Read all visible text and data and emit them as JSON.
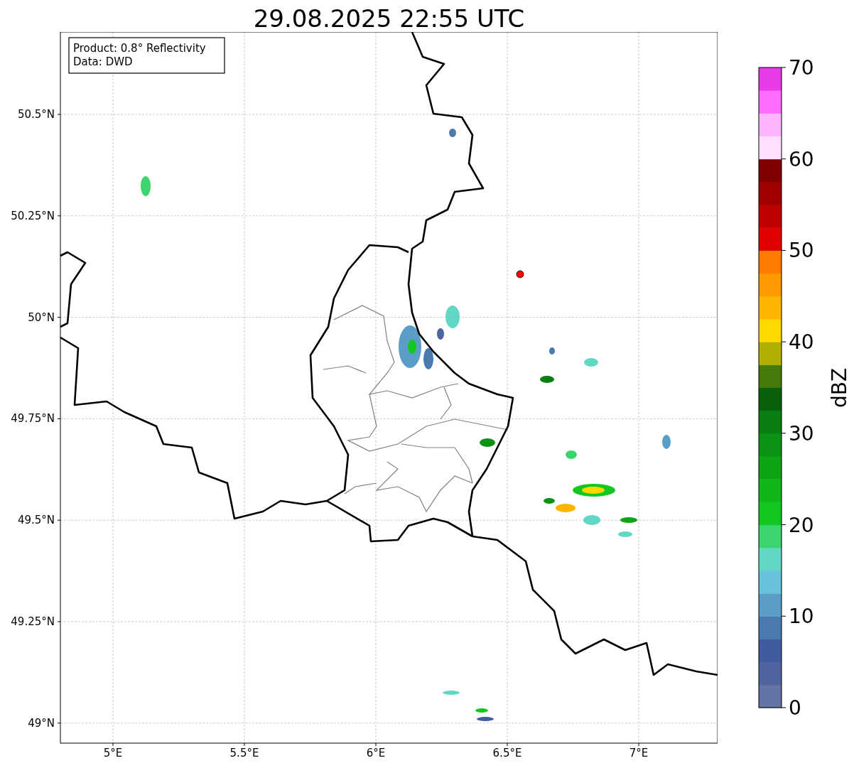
{
  "title": "29.08.2025 22:55 UTC",
  "map": {
    "info_lines": [
      "Product: 0.8° Reflectivity",
      "Data: DWD"
    ],
    "lon_labels": [
      "5°E",
      "5.5°E",
      "6°E",
      "6.5°E",
      "7°E"
    ],
    "lat_labels": [
      "50.5°N",
      "50.25°N",
      "50°N",
      "49.75°N",
      "49.5°N",
      "49.25°N",
      "49°N"
    ]
  },
  "colorbar": {
    "label": "dBZ",
    "ticks": [
      "70",
      "60",
      "50",
      "40",
      "30",
      "20",
      "10",
      "0"
    ],
    "bins": [
      {
        "color": "#6474a6"
      },
      {
        "color": "#5064a0"
      },
      {
        "color": "#405ca0"
      },
      {
        "color": "#4a7ab0"
      },
      {
        "color": "#5a9ec8"
      },
      {
        "color": "#68c2dc"
      },
      {
        "color": "#60d8c4"
      },
      {
        "color": "#3cd46c"
      },
      {
        "color": "#12c81e"
      },
      {
        "color": "#10b61a"
      },
      {
        "color": "#0ea416"
      },
      {
        "color": "#0c9214"
      },
      {
        "color": "#0a7e12"
      },
      {
        "color": "#085f0c"
      },
      {
        "color": "#467a0a"
      },
      {
        "color": "#b0b000"
      },
      {
        "color": "#ffd800"
      },
      {
        "color": "#ffb400"
      },
      {
        "color": "#ff9a00"
      },
      {
        "color": "#ff7c00"
      },
      {
        "color": "#e00000"
      },
      {
        "color": "#c00000"
      },
      {
        "color": "#a00000"
      },
      {
        "color": "#800000"
      },
      {
        "color": "#ffe0ff"
      },
      {
        "color": "#ffb4ff"
      },
      {
        "color": "#ff6cff"
      },
      {
        "color": "#e83ae8"
      }
    ]
  }
}
